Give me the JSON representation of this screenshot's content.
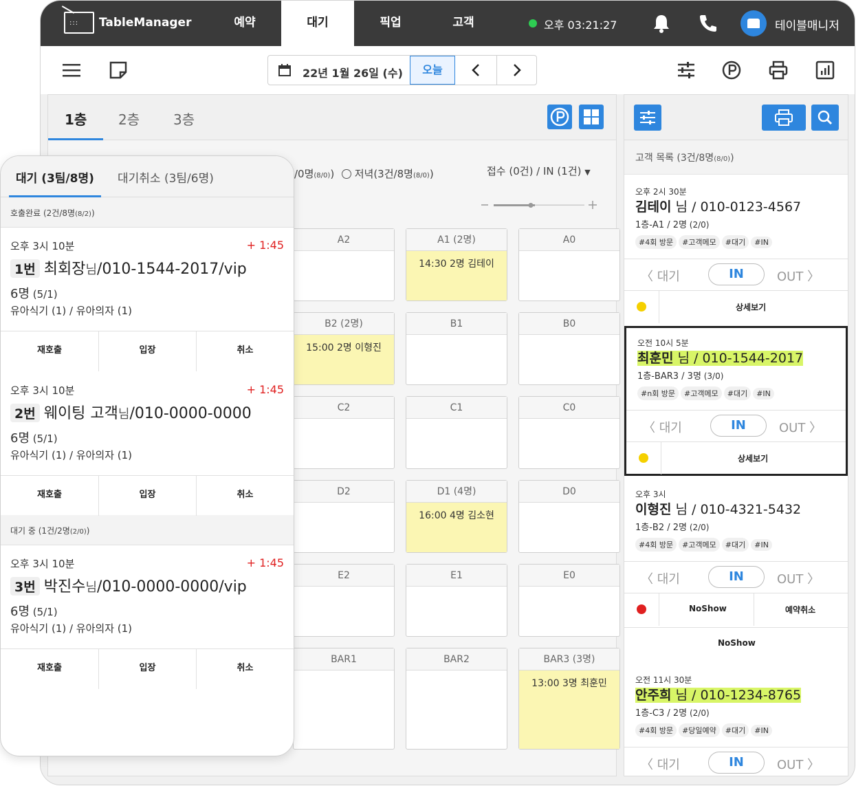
{
  "brand": "TableManager",
  "nav": {
    "tabs": [
      "예약",
      "대기",
      "픽업",
      "고객"
    ],
    "active": 1,
    "clock": "오후 03:21:27",
    "user": "테이블매니저"
  },
  "colors": {
    "accent": "#2e86de",
    "nav_bg": "#3a3a3a",
    "highlight": "#d8f567",
    "reservation": "#fbf6b3",
    "online": "#2ecc52",
    "late": "#e02020"
  },
  "toolbar": {
    "date": "22년 1월 26일 (수)",
    "today": "오늘"
  },
  "floor": {
    "tabs": [
      "1층",
      "2층",
      "3층"
    ],
    "filter_partial": "/0명",
    "filter_partial_sub": "(8/0)",
    "filter_dinner": "저녁(3건/8명",
    "filter_dinner_sub": "(8/0)",
    "filter_dinner_close": ")",
    "accept_summary": "접수 (0건) / IN (1건)",
    "tables": [
      {
        "label": "A2",
        "res": ""
      },
      {
        "label": "A1 (2명)",
        "res": "14:30 2명 김테이"
      },
      {
        "label": "A0",
        "res": ""
      },
      {
        "label": "B2 (2명)",
        "res": "15:00 2명 이형진"
      },
      {
        "label": "B1",
        "res": ""
      },
      {
        "label": "B0",
        "res": ""
      },
      {
        "label": "C2",
        "res": ""
      },
      {
        "label": "C1",
        "res": ""
      },
      {
        "label": "C0",
        "res": ""
      },
      {
        "label": "D2",
        "res": ""
      },
      {
        "label": "D1 (4명)",
        "res": "16:00 4명 김소현"
      },
      {
        "label": "D0",
        "res": ""
      },
      {
        "label": "E2",
        "res": ""
      },
      {
        "label": "E1",
        "res": ""
      },
      {
        "label": "E0",
        "res": ""
      },
      {
        "label": "BAR1",
        "res": ""
      },
      {
        "label": "BAR2",
        "res": ""
      },
      {
        "label": "BAR3 (3명)",
        "res": "13:00 3명 최훈민"
      }
    ]
  },
  "customers": {
    "title": "고객 목록 (3건/8명",
    "title_sub": "(8/0)",
    "title_close": ")",
    "actions": {
      "wait": "대기",
      "in": "IN",
      "out": "OUT",
      "detail": "상세보기",
      "noshow": "NoShow",
      "cancel_res": "예약취소"
    },
    "cards": [
      {
        "time": "오후 2시 30분",
        "name": "김테이",
        "suffix": " 님 / 010-0123-4567",
        "sub": "1층-A1 / 2명",
        "sub_small": " (2/0)",
        "tags": [
          "#4회 방문",
          "#고객메모",
          "#대기",
          "#IN"
        ],
        "highlight": false
      },
      {
        "time": "오전 10시 5분",
        "name": "최훈민",
        "suffix": " 님 / 010-1544-2017",
        "sub": "1층-BAR3 / 3명",
        "sub_small": " (3/0)",
        "tags": [
          "#n회 방문",
          "#고객메모",
          "#대기",
          "#IN"
        ],
        "highlight": true
      },
      {
        "time": "오후 3시",
        "name": "이형진",
        "suffix": " 님 / 010-4321-5432",
        "sub": "1층-B2 / 2명",
        "sub_small": " (2/0)",
        "tags": [
          "#4회 방문",
          "#고객메모",
          "#대기",
          "#IN"
        ],
        "highlight": false
      },
      {
        "time": "오전 11시 30분",
        "name": "안주희",
        "suffix": " 님 / 010-1234-8765",
        "sub": "1층-C3 / 2명",
        "sub_small": " (2/0)",
        "tags": [
          "#4회 방문",
          "#당일예약",
          "#대기",
          "#IN"
        ],
        "highlight": true
      }
    ]
  },
  "waitlist": {
    "tabs": [
      "대기 (3팀/8명)",
      "대기취소 (3팀/6명)"
    ],
    "sections": [
      {
        "label": "호출완료 (2건/8명",
        "sub": "(8/2)",
        "close": ")"
      },
      {
        "label": "대기 중 (1건/2명",
        "sub": "(2/0)",
        "close": ")"
      }
    ],
    "buttons": [
      "재호출",
      "입장",
      "취소"
    ],
    "items": [
      {
        "time": "오후 3시 10분",
        "elapsed": "+ 1:45",
        "num": "1번",
        "name": "최회장",
        "nim": "님",
        "phone": "/010-1544-2017/vip",
        "count": "6명",
        "count_sub": " (5/1)",
        "extra": "유아식기 (1) / 유아의자 (1)"
      },
      {
        "time": "오후 3시 10분",
        "elapsed": "+ 1:45",
        "num": "2번",
        "name": "웨이팅 고객",
        "nim": "님",
        "phone": "/010-0000-0000",
        "count": "6명",
        "count_sub": " (5/1)",
        "extra": "유아식기 (1) / 유아의자 (1)"
      },
      {
        "time": "오후 3시 10분",
        "elapsed": "+ 1:45",
        "num": "3번",
        "name": "박진수",
        "nim": "님",
        "phone": "/010-0000-0000/vip",
        "count": "6명",
        "count_sub": " (5/1)",
        "extra": "유아식기 (1) / 유아의자 (1)"
      }
    ]
  }
}
